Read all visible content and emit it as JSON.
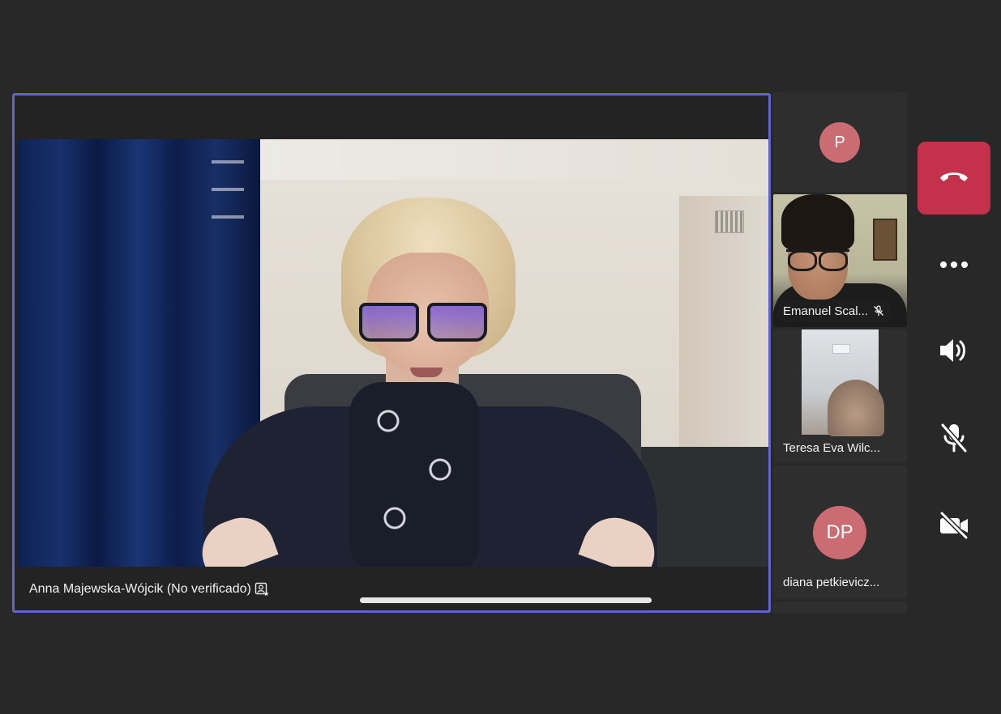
{
  "main_speaker": {
    "name": "Anna Majewska-Wójcik (No verificado)",
    "icon": "presenter-badge-icon"
  },
  "gallery": [
    {
      "type": "avatar",
      "initials": "P",
      "name": "",
      "color": "#cb6b72"
    },
    {
      "type": "video",
      "name": "Emanuel Scal...",
      "muted": true
    },
    {
      "type": "video",
      "name": "Teresa Eva Wilc..."
    },
    {
      "type": "avatar",
      "initials": "DP",
      "name": "diana petkievicz...",
      "color": "#cb6b72"
    }
  ],
  "controls": {
    "hangup": "hang-up-icon",
    "more": "more-options-icon",
    "speaker": "speaker-icon",
    "mic": "mic-off-icon",
    "camera": "camera-off-icon"
  },
  "colors": {
    "background": "#282828",
    "active_border": "#6264c8",
    "hangup": "#c4314b",
    "avatar": "#cb6b72"
  }
}
